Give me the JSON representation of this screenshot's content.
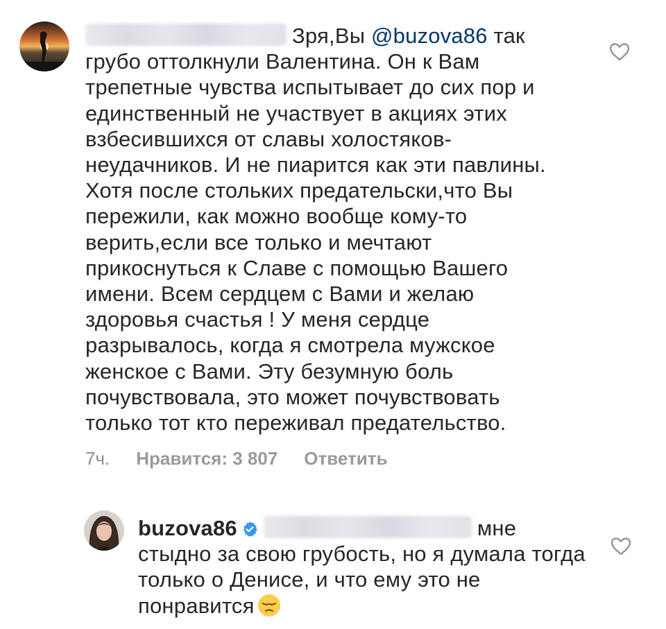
{
  "comment1": {
    "avatar_icon": "sunset-avatar",
    "prefix": "Зря,Вы ",
    "mention": "@buzova86",
    "text": " так грубо оттолкнули Валентина. Он к Вам трепетные чувства испытывает до сих пор и единственный не участвует в акциях этих взбесившихся от славы холостяков-неудачников. И не пиарится как эти павлины. Хотя после стольких предательски,что Вы пережили, как можно вообще кому-то верить,если все только и мечтают прикоснуться к Славе с помощью Вашего имени. Всем сердцем с Вами и желаю здоровья счастья ! У меня сердце разрывалось, когда я смотрела мужское женское с Вами. Эту безумную боль почувствовала, это может почувствовать только тот кто переживал предательство.",
    "time": "7ч.",
    "likes": "Нравится: 3 807",
    "reply": "Ответить",
    "like_icon": "heart-outline-icon"
  },
  "comment2": {
    "avatar_icon": "woman-portrait-avatar",
    "username": "buzova86",
    "verified_icon": "verified-badge-icon",
    "text": "мне стыдно за свою грубость, но я думала тогда только о Денисе, и что ему это не понравится",
    "emoji": "😔",
    "like_icon": "heart-outline-icon"
  },
  "colors": {
    "mention": "#00376b",
    "meta": "#8e8e8e",
    "verified": "#3897f0"
  }
}
